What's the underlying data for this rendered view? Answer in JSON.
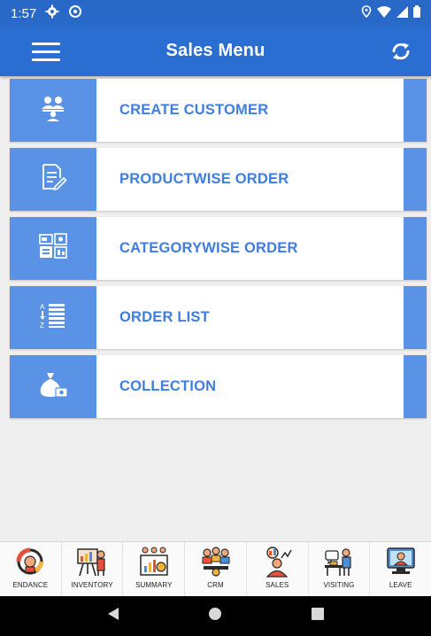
{
  "status_bar": {
    "time": "1:57"
  },
  "app_bar": {
    "title": "Sales Menu"
  },
  "menu": {
    "items": [
      {
        "label": "CREATE CUSTOMER",
        "icon": "customers-icon"
      },
      {
        "label": "PRODUCTWISE ORDER",
        "icon": "document-edit-icon"
      },
      {
        "label": "CATEGORYWISE ORDER",
        "icon": "category-icon"
      },
      {
        "label": "ORDER LIST",
        "icon": "sorted-list-icon"
      },
      {
        "label": "COLLECTION",
        "icon": "money-bag-icon"
      }
    ]
  },
  "bottom_nav": {
    "items": [
      {
        "label": "ENDANCE",
        "icon": "attendance-icon"
      },
      {
        "label": "INVENTORY",
        "icon": "inventory-icon"
      },
      {
        "label": "SUMMARY",
        "icon": "summary-icon"
      },
      {
        "label": "CRM",
        "icon": "crm-icon"
      },
      {
        "label": "SALES",
        "icon": "sales-icon"
      },
      {
        "label": "VISITING",
        "icon": "visiting-icon"
      },
      {
        "label": "LEAVE",
        "icon": "leave-icon"
      }
    ]
  },
  "colors": {
    "status_bar": "#2869c8",
    "app_bar": "#2b6ed1",
    "menu_accent": "#5a93e6",
    "menu_text": "#3f7de0",
    "background": "#efefef"
  }
}
